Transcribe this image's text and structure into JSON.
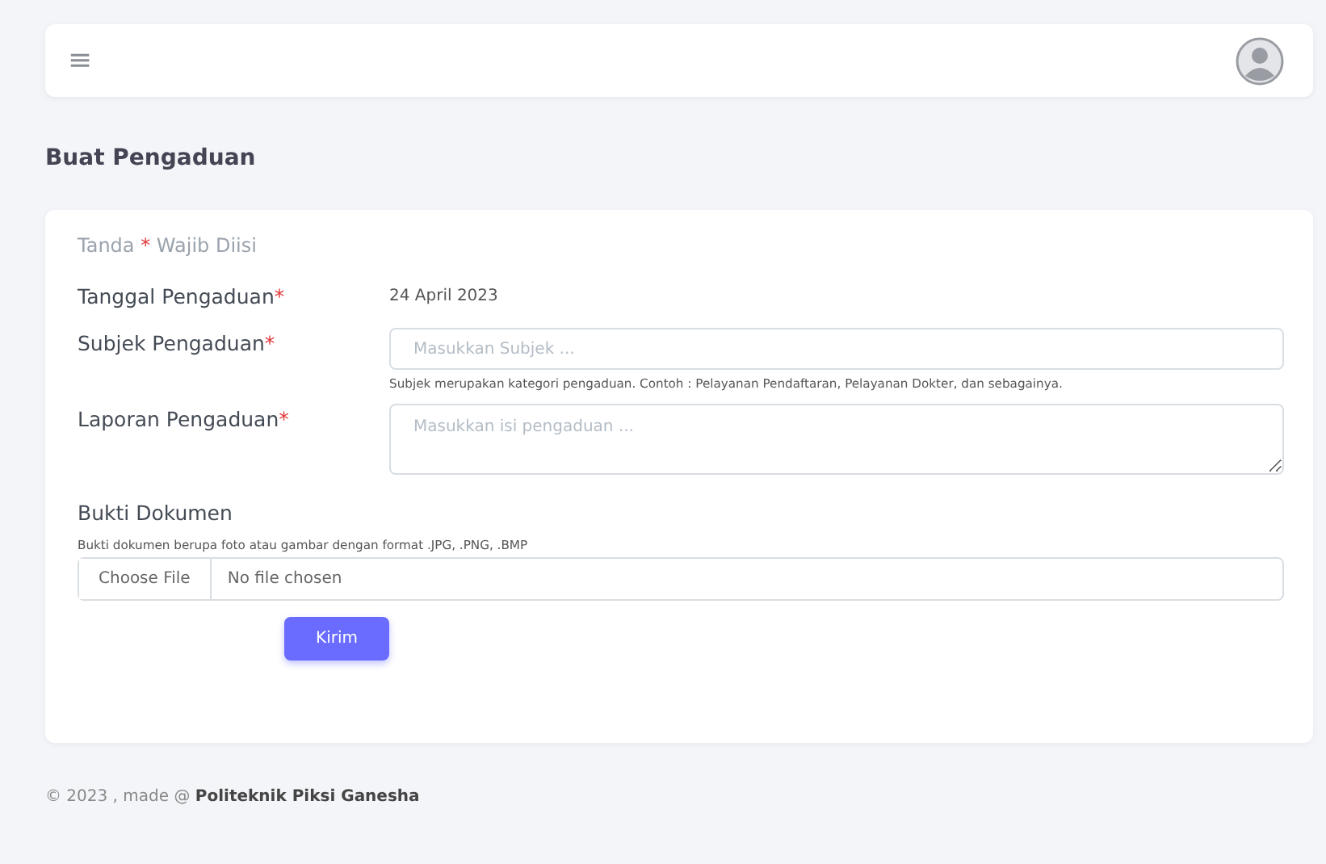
{
  "navbar": {
    "menu_icon": "≡"
  },
  "page_title": "Buat Pengaduan",
  "form": {
    "legend": {
      "before": "Tanda",
      "mark": "*",
      "after": "Wajib Diisi"
    },
    "fields": [
      {
        "kind": "static",
        "label": "Tanggal Pengaduan",
        "mark": "*",
        "value": "24 April 2023"
      },
      {
        "kind": "input",
        "label": "Subjek Pengaduan",
        "mark": "*",
        "placeholder": "Masukkan Subjek ...",
        "help": "Subjek merupakan kategori pengaduan. Contoh : Pelayanan Pendaftaran, Pelayanan Dokter, dan sebagainya."
      },
      {
        "kind": "textarea",
        "label": "Laporan Pengaduan",
        "mark": "*",
        "placeholder": "Masukkan isi pengaduan ..."
      }
    ],
    "upload": {
      "label": "Bukti Dokumen",
      "help": "Bukti dokumen berupa foto atau gambar dengan format .JPG, .PNG, .BMP",
      "button": "Choose File",
      "status": "No file chosen"
    },
    "submit": "Kirim"
  },
  "footer": {
    "text": "© 2023 , made @ ",
    "link": "Politeknik Piksi Ganesha"
  }
}
